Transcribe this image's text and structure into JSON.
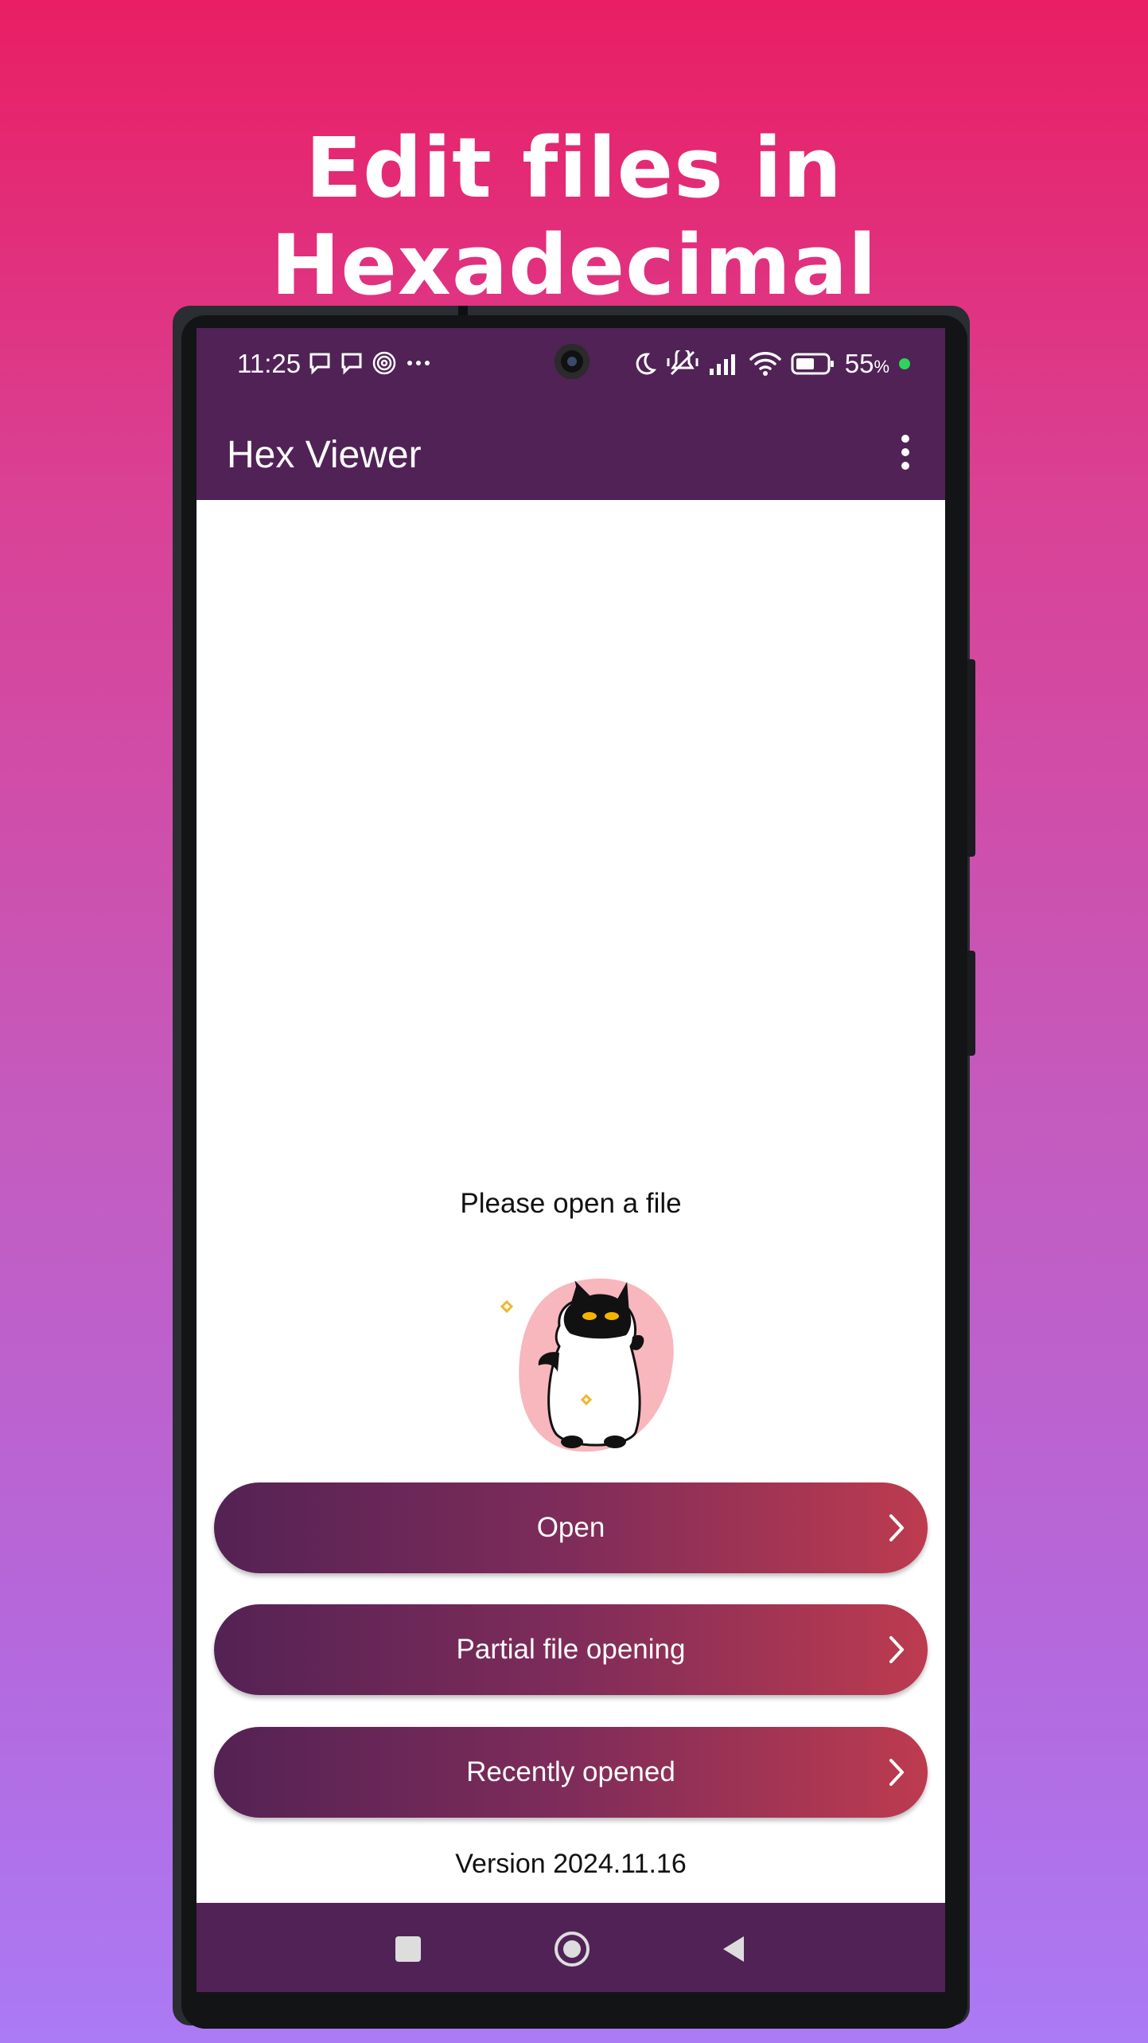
{
  "headline": "Edit files in Hexadecimal",
  "status_bar": {
    "time": "11:25",
    "battery": "55",
    "battery_unit": "%",
    "left_icons": [
      "message-icon",
      "message-icon",
      "fingerprint-icon",
      "more-notifications-icon"
    ],
    "right_icons": [
      "moon-icon",
      "vibrate-off-icon",
      "signal-icon",
      "wifi-icon",
      "battery-icon",
      "charging-dot-icon"
    ]
  },
  "app_bar": {
    "title": "Hex Viewer",
    "menu_icon": "more-vert-icon"
  },
  "main": {
    "hint": "Please open a file",
    "illustration": "cat-illustration",
    "buttons": [
      {
        "label": "Open",
        "icon": "chevron-right-icon"
      },
      {
        "label": "Partial file opening",
        "icon": "chevron-right-icon"
      },
      {
        "label": "Recently opened",
        "icon": "chevron-right-icon"
      }
    ],
    "version": "Version 2024.11.16"
  },
  "nav_bar": {
    "buttons": [
      "recents-square-icon",
      "home-circle-icon",
      "back-triangle-icon"
    ]
  },
  "colors": {
    "app_bar": "#502256",
    "button_start": "#542254",
    "button_end": "#bd3b4f",
    "bg_top": "#e91e63",
    "bg_bottom": "#ab7af5"
  }
}
